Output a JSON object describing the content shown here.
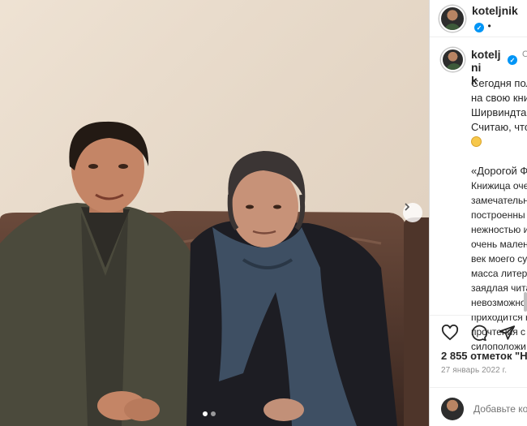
{
  "post": {
    "username": "koteljnik",
    "header_more": "•",
    "caption_user_part1": "koteljni",
    "caption_user_part2": "k",
    "caption_time_initial": "О",
    "caption_lines": [
      "Сегодня пол",
      "на свою книг",
      "Ширвиндта.",
      "Считаю, что"
    ],
    "caption_lines_2": [
      "«Дорогой Фи",
      "Книжица оче",
      "замечательн",
      "построенны",
      "нежностью и",
      "очень мален",
      "век моего су",
      "масса литера",
      "заядлая чита",
      "невозможно",
      "приходится н",
      "прочтения с",
      "силоположи"
    ],
    "likes": "2 855 отметок \"Нр",
    "date": "27 январь 2022 г.",
    "comment_placeholder": "Добавьте комм"
  },
  "carousel": {
    "total_slides": 2,
    "active_slide": 1
  },
  "icons": {
    "like": "heart-icon",
    "comment": "comment-icon",
    "share": "share-icon",
    "next": "chevron-right-icon",
    "verified": "verified-badge-icon"
  },
  "colors": {
    "verified": "#0095f6",
    "text": "#262626",
    "muted": "#8e8e8e",
    "border": "#dbdbdb"
  }
}
